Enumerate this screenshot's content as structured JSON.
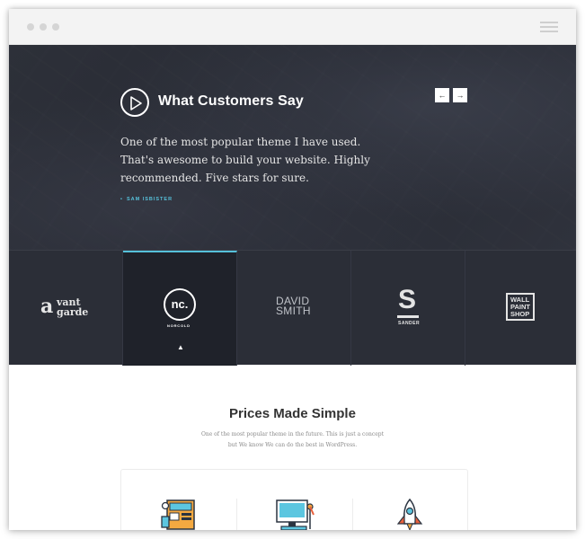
{
  "hero": {
    "title": "What Customers Say",
    "quote": "One of the most popular theme I have used. That's awesome to build your website. Highly recommended. Five stars for sure.",
    "author": "SAM ISBISTER",
    "prev_arrow": "←",
    "next_arrow": "→"
  },
  "logos": [
    {
      "name": "vantgarde",
      "mark": "a",
      "line1": "vant",
      "line2": "garde"
    },
    {
      "name": "norcold",
      "mark": "nc.",
      "sub": "NORCOLD",
      "active": true
    },
    {
      "name": "davidsmith",
      "line1": "DAVID",
      "line2": "SMITH"
    },
    {
      "name": "sander",
      "mark": "S",
      "sub": "SANDER"
    },
    {
      "name": "wallpaintshop",
      "line1": "WALL",
      "line2": "PAINT",
      "line3": "SHOP"
    }
  ],
  "pricing": {
    "title": "Prices Made Simple",
    "subtitle": "One of the most popular theme in the future. This is just a concept but We know We can do the best in WordPress."
  },
  "colors": {
    "accent": "#56c1da",
    "hero_bg": "#2b2e37"
  },
  "icons": [
    "play-icon",
    "arrow-left-icon",
    "arrow-right-icon",
    "hamburger-icon",
    "web-design-icon",
    "desktop-icon",
    "rocket-icon"
  ]
}
